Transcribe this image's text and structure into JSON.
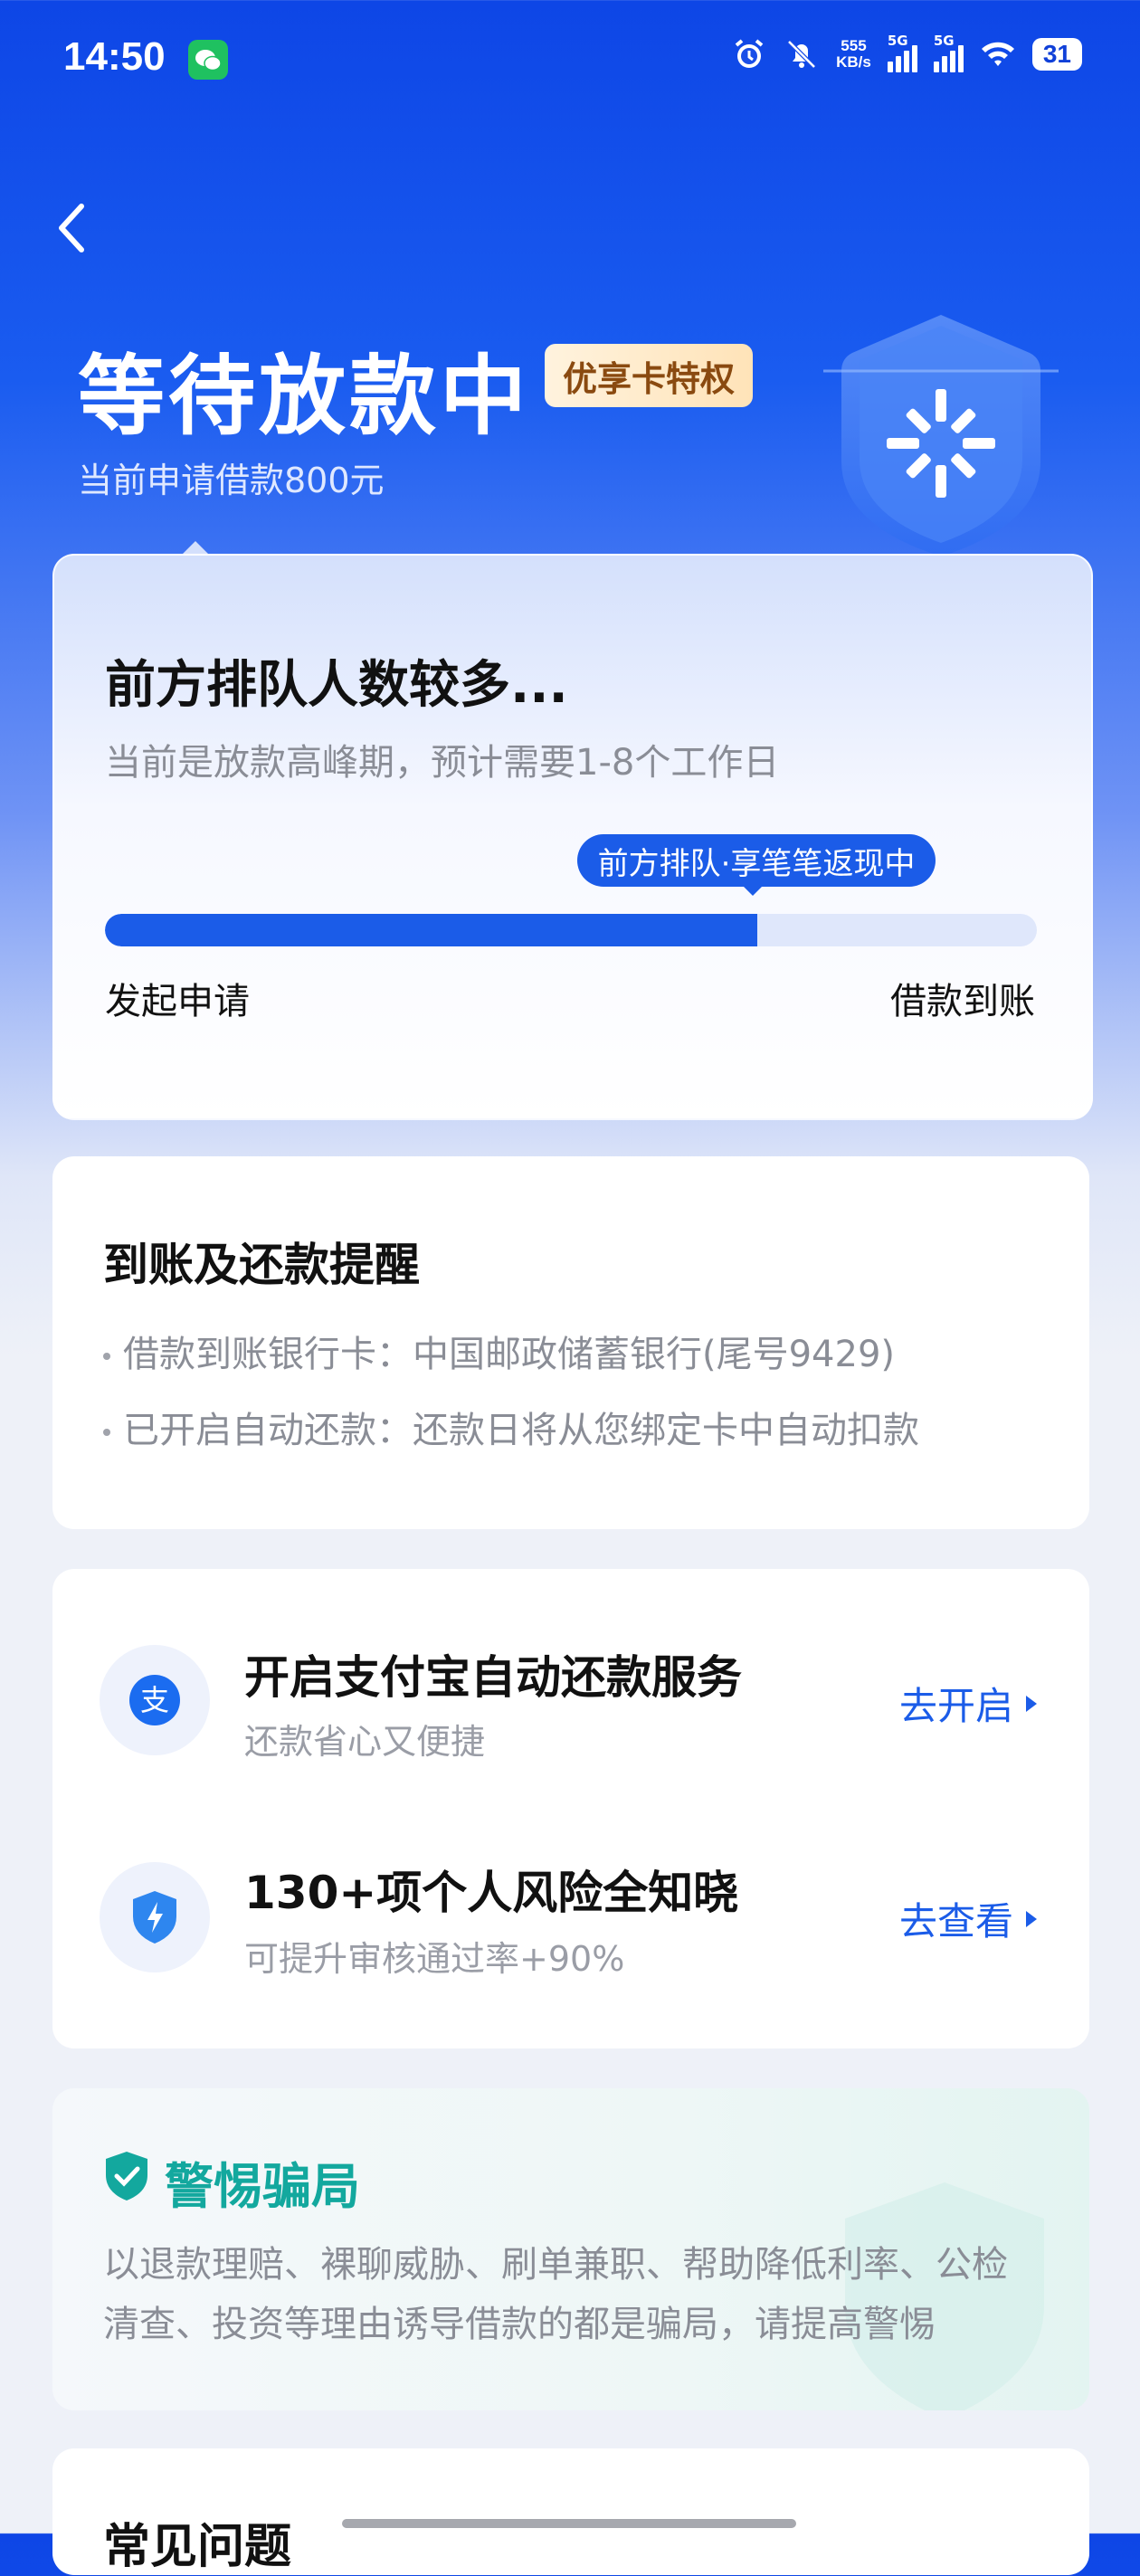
{
  "status_bar": {
    "time": "14:50",
    "net_speed_value": "555",
    "net_speed_unit": "KB/s",
    "signal_1": "5G",
    "signal_2": "5G",
    "battery": "31",
    "icons": [
      "wechat-icon",
      "alarm-icon",
      "mute-bell-icon",
      "signal-icon",
      "wifi-icon"
    ]
  },
  "header": {
    "title": "等待放款中",
    "badge": "优享卡特权",
    "subtitle": "当前申请借款800元"
  },
  "progress": {
    "title": "前方排队人数较多...",
    "description": "当前是放款高峰期，预计需要1-8个工作日",
    "tooltip": "前方排队·享笔笔返现中",
    "start_label": "发起申请",
    "end_label": "借款到账",
    "progress_fraction": 0.7,
    "accent_color": "#1b5ce8"
  },
  "reminder": {
    "title": "到账及还款提醒",
    "items": [
      "借款到账银行卡：中国邮政储蓄银行(尾号9429)",
      "已开启自动还款：还款日将从您绑定卡中自动扣款"
    ]
  },
  "services": [
    {
      "icon": "alipay-icon",
      "title": "开启支付宝自动还款服务",
      "subtitle": "还款省心又便捷",
      "action": "去开启"
    },
    {
      "icon": "shield-bolt-icon",
      "title": "130+项个人风险全知晓",
      "subtitle": "可提升审核通过率+90%",
      "action": "去查看"
    }
  ],
  "fraud_warning": {
    "title": "警惕骗局",
    "body": "以退款理赔、裸聊威胁、刷单兼职、帮助降低利率、公检清查、投资等理由诱导借款的都是骗局，请提高警惕",
    "color": "#13a89e"
  },
  "faq": {
    "title": "常见问题"
  }
}
